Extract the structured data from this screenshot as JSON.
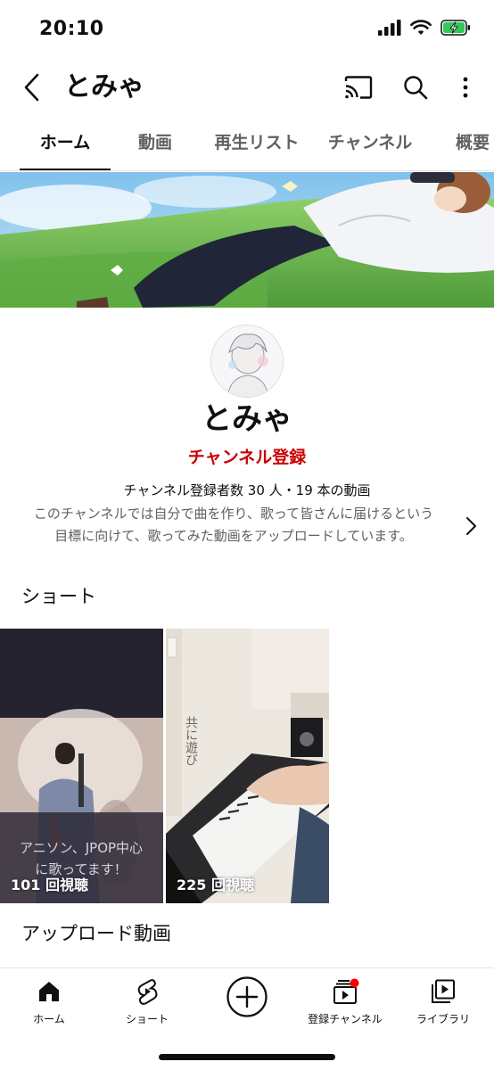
{
  "status_bar": {
    "time": "20:10"
  },
  "header": {
    "title": "とみゃ"
  },
  "tabs": [
    {
      "label": "ホーム",
      "active": true
    },
    {
      "label": "動画",
      "active": false
    },
    {
      "label": "再生リスト",
      "active": false
    },
    {
      "label": "チャンネル",
      "active": false
    },
    {
      "label": "概要",
      "active": false
    }
  ],
  "channel": {
    "name": "とみゃ",
    "subscribe_label": "チャンネル登録",
    "stats": "チャンネル登録者数 30 人・19 本の動画",
    "description_line1": "このチャンネルでは自分で曲を作り、歌って皆さんに届けるという",
    "description_line2": "目標に向けて、歌ってみた動画をアップロードしています。"
  },
  "sections": {
    "shorts_title": "ショート",
    "uploads_title": "アップロード動画"
  },
  "shorts": [
    {
      "overlay_line1": "アニソン、JPOP中心",
      "overlay_line2": "に歌ってます！",
      "views": "101 回視聴"
    },
    {
      "vertical_text": "共に遊び",
      "views": "225 回視聴"
    }
  ],
  "bottom_nav": {
    "home": "ホーム",
    "shorts": "ショート",
    "subscriptions": "登録チャンネル",
    "library": "ライブラリ"
  },
  "colors": {
    "accent_red": "#cc0000",
    "text_primary": "#0f0f0f",
    "text_secondary": "#606060",
    "battery_green": "#34c759"
  }
}
